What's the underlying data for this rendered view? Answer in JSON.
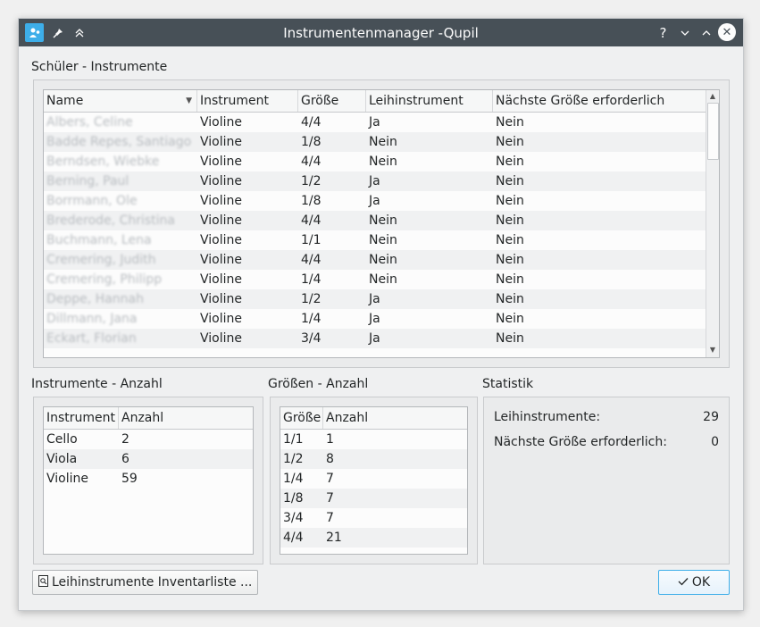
{
  "window": {
    "title": "Instrumentenmanager -Qupil"
  },
  "students": {
    "section_title": "Schüler - Instrumente",
    "columns": [
      "Name",
      "Instrument",
      "Größe",
      "Leihinstrument",
      "Nächste Größe erforderlich"
    ],
    "rows": [
      [
        "Albers, Celine",
        "Violine",
        "4/4",
        "Ja",
        "Nein"
      ],
      [
        "Badde Repes, Santiago",
        "Violine",
        "1/8",
        "Nein",
        "Nein"
      ],
      [
        "Berndsen, Wiebke",
        "Violine",
        "4/4",
        "Nein",
        "Nein"
      ],
      [
        "Berning, Paul",
        "Violine",
        "1/2",
        "Ja",
        "Nein"
      ],
      [
        "Borrmann, Ole",
        "Violine",
        "1/8",
        "Ja",
        "Nein"
      ],
      [
        "Brederode, Christina",
        "Violine",
        "4/4",
        "Nein",
        "Nein"
      ],
      [
        "Buchmann, Lena",
        "Violine",
        "1/1",
        "Nein",
        "Nein"
      ],
      [
        "Cremering, Judith",
        "Violine",
        "4/4",
        "Nein",
        "Nein"
      ],
      [
        "Cremering, Philipp",
        "Violine",
        "1/4",
        "Nein",
        "Nein"
      ],
      [
        "Deppe, Hannah",
        "Violine",
        "1/2",
        "Ja",
        "Nein"
      ],
      [
        "Dillmann, Jana",
        "Violine",
        "1/4",
        "Ja",
        "Nein"
      ],
      [
        "Eckart, Florian",
        "Violine",
        "3/4",
        "Ja",
        "Nein"
      ]
    ]
  },
  "instruments": {
    "section_title": "Instrumente - Anzahl",
    "columns": [
      "Instrument",
      "Anzahl"
    ],
    "rows": [
      [
        "Cello",
        "2"
      ],
      [
        "Viola",
        "6"
      ],
      [
        "Violine",
        "59"
      ]
    ]
  },
  "sizes": {
    "section_title": "Größen - Anzahl",
    "columns": [
      "Größe",
      "Anzahl"
    ],
    "rows": [
      [
        "1/1",
        "1"
      ],
      [
        "1/2",
        "8"
      ],
      [
        "1/4",
        "7"
      ],
      [
        "1/8",
        "7"
      ],
      [
        "3/4",
        "7"
      ],
      [
        "4/4",
        "21"
      ]
    ]
  },
  "statistics": {
    "section_title": "Statistik",
    "items": [
      {
        "label": "Leihinstrumente:",
        "value": "29"
      },
      {
        "label": "Nächste Größe erforderlich:",
        "value": "0"
      }
    ]
  },
  "buttons": {
    "inventory_label": "Leihinstrumente Inventarliste ...",
    "ok_label": "OK"
  },
  "icons": {
    "app": "app-icon",
    "pin": "pin-icon",
    "shade": "shade-icon",
    "help": "help-icon",
    "minimize": "minimize-icon",
    "maximize": "maximize-icon",
    "close": "close-icon",
    "sort": "sort-descending-icon",
    "inventory": "document-icon",
    "ok": "checkmark-icon"
  },
  "colors": {
    "titlebar": "#475057",
    "accent": "#3daee9",
    "background": "#eff0f1"
  }
}
